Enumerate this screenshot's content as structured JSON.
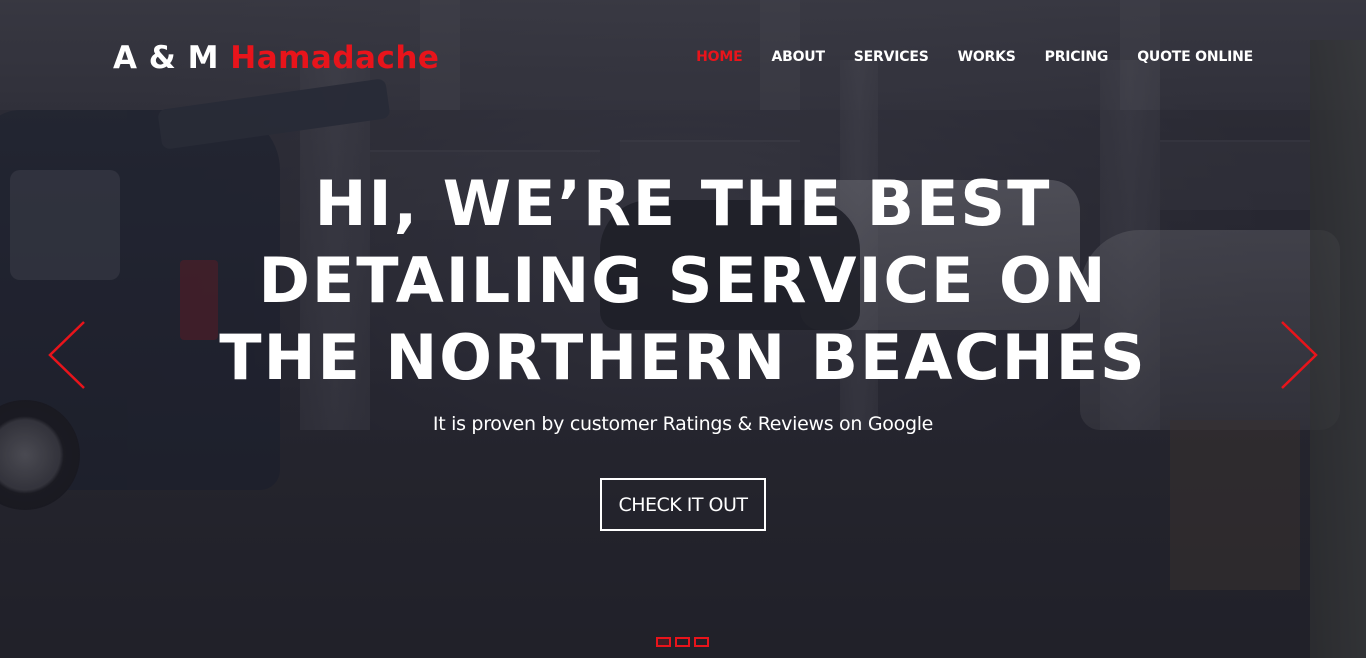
{
  "brand": {
    "main": "A & M",
    "accent": "Hamadache"
  },
  "nav": {
    "items": [
      {
        "label": "HOME",
        "active": true
      },
      {
        "label": "ABOUT",
        "active": false
      },
      {
        "label": "SERVICES",
        "active": false
      },
      {
        "label": "WORKS",
        "active": false
      },
      {
        "label": "PRICING",
        "active": false
      },
      {
        "label": "QUOTE ONLINE",
        "active": false
      }
    ]
  },
  "hero": {
    "headline_lines": [
      "HI, WE’RE THE BEST",
      "DETAILING SERVICE ON",
      "THE NORTHERN BEACHES"
    ],
    "subtitle": "It is proven by customer Ratings & Reviews on Google",
    "cta_label": "CHECK IT OUT"
  },
  "carousel": {
    "prev_icon": "chevron-left-icon",
    "next_icon": "chevron-right-icon",
    "slide_count": 3,
    "active_slide": 1
  },
  "colors": {
    "accent": "#e8141b",
    "text": "#ffffff",
    "overlay": "#191923"
  }
}
